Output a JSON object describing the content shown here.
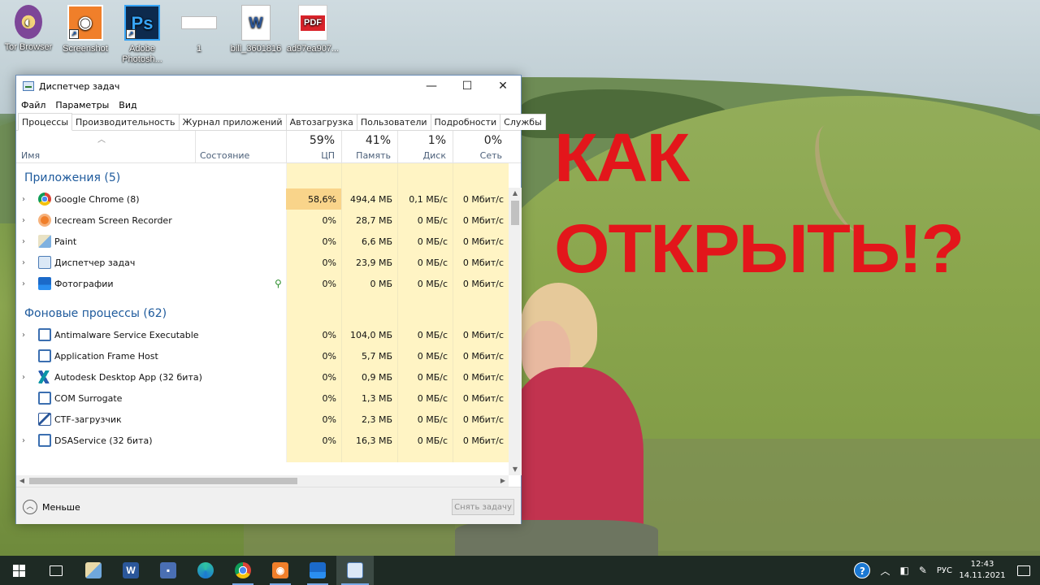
{
  "overlay": {
    "line1": "КАК",
    "line2": "ОТКРЫТЬ!?"
  },
  "desktop": {
    "icons": [
      {
        "label": "Tor Browser",
        "glyph": "◐"
      },
      {
        "label": "Screenshot",
        "glyph": "◉"
      },
      {
        "label": "Adobe Photosh...",
        "glyph": "Ps"
      },
      {
        "label": "1",
        "glyph": ""
      },
      {
        "label": "bill_3601816",
        "glyph": "W"
      },
      {
        "label": "ad97ea907...",
        "glyph": "PDF"
      }
    ]
  },
  "window": {
    "title": "Диспетчер задач",
    "menu": [
      "Файл",
      "Параметры",
      "Вид"
    ],
    "tabs": [
      "Процессы",
      "Производительность",
      "Журнал приложений",
      "Автозагрузка",
      "Пользователи",
      "Подробности",
      "Службы"
    ],
    "columns": {
      "name": "Имя",
      "status": "Состояние",
      "cpu": {
        "pct": "59%",
        "label": "ЦП"
      },
      "mem": {
        "pct": "41%",
        "label": "Память"
      },
      "disk": {
        "pct": "1%",
        "label": "Диск"
      },
      "net": {
        "pct": "0%",
        "label": "Сеть"
      }
    },
    "groups": {
      "apps": "Приложения (5)",
      "background": "Фоновые процессы (62)"
    },
    "apps": [
      {
        "name": "Google Chrome (8)",
        "cpu": "58,6%",
        "mem": "494,4 МБ",
        "disk": "0,1 МБ/с",
        "net": "0 Мбит/с"
      },
      {
        "name": "Icecream Screen Recorder",
        "cpu": "0%",
        "mem": "28,7 МБ",
        "disk": "0 МБ/с",
        "net": "0 Мбит/с"
      },
      {
        "name": "Paint",
        "cpu": "0%",
        "mem": "6,6 МБ",
        "disk": "0 МБ/с",
        "net": "0 Мбит/с"
      },
      {
        "name": "Диспетчер задач",
        "cpu": "0%",
        "mem": "23,9 МБ",
        "disk": "0 МБ/с",
        "net": "0 Мбит/с"
      },
      {
        "name": "Фотографии",
        "cpu": "0%",
        "mem": "0 МБ",
        "disk": "0 МБ/с",
        "net": "0 Мбит/с"
      }
    ],
    "background": [
      {
        "name": "Antimalware Service Executable",
        "cpu": "0%",
        "mem": "104,0 МБ",
        "disk": "0 МБ/с",
        "net": "0 Мбит/с"
      },
      {
        "name": "Application Frame Host",
        "cpu": "0%",
        "mem": "5,7 МБ",
        "disk": "0 МБ/с",
        "net": "0 Мбит/с"
      },
      {
        "name": "Autodesk Desktop App (32 бита)",
        "cpu": "0%",
        "mem": "0,9 МБ",
        "disk": "0 МБ/с",
        "net": "0 Мбит/с"
      },
      {
        "name": "COM Surrogate",
        "cpu": "0%",
        "mem": "1,3 МБ",
        "disk": "0 МБ/с",
        "net": "0 Мбит/с"
      },
      {
        "name": "CTF-загрузчик",
        "cpu": "0%",
        "mem": "2,3 МБ",
        "disk": "0 МБ/с",
        "net": "0 Мбит/с"
      },
      {
        "name": "DSAService (32 бита)",
        "cpu": "0%",
        "mem": "16,3 МБ",
        "disk": "0 МБ/с",
        "net": "0 Мбит/с"
      }
    ],
    "footer": {
      "less": "Меньше",
      "end_task": "Снять задачу"
    }
  },
  "taskbar": {
    "lang": "РУС",
    "time": "12:43",
    "date": "14.11.2021"
  },
  "colors": {
    "headline": "#e3161b",
    "cpu_hot": "#f9d48a",
    "cpu_warm": "#fff4c4",
    "group_text": "#1e5a9c"
  }
}
